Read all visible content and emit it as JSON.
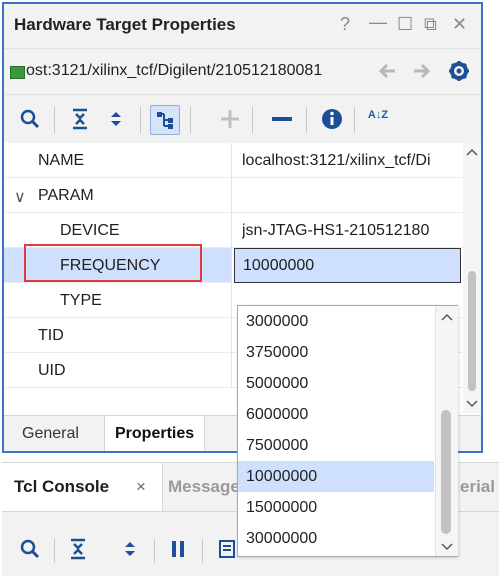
{
  "panel": {
    "title": "Hardware Target Properties",
    "window_controls": [
      "?",
      "—",
      "☐",
      "⧉",
      "✕"
    ],
    "path": "ost:3121/xilinx_tcf/Digilent/210512180081",
    "path_buttons": {
      "back": "back-arrow-icon",
      "forward": "forward-arrow-icon",
      "settings": "gear-icon"
    },
    "toolbar_icons": [
      "search-icon",
      "collapse-all-icon",
      "expand-all-icon",
      "group-icon",
      "add-icon",
      "remove-icon",
      "info-icon",
      "sort-icon"
    ],
    "sort_label": "A↓Z",
    "properties": [
      {
        "name": "NAME",
        "value": "localhost:3121/xilinx_tcf/Di",
        "indent": 0
      },
      {
        "name": "PARAM",
        "value": "",
        "indent": 0,
        "expander": "∨"
      },
      {
        "name": "DEVICE",
        "value": "jsn-JTAG-HS1-210512180",
        "indent": 1
      },
      {
        "name": "FREQUENCY",
        "value": "10000000",
        "indent": 1,
        "selected": true
      },
      {
        "name": "TYPE",
        "value": "",
        "indent": 1
      },
      {
        "name": "TID",
        "value": "",
        "indent": 0
      },
      {
        "name": "UID",
        "value": "",
        "indent": 0
      }
    ],
    "tabs": [
      {
        "label": "General",
        "active": false
      },
      {
        "label": "Properties",
        "active": true
      }
    ]
  },
  "dropdown": {
    "options": [
      "3000000",
      "3750000",
      "5000000",
      "6000000",
      "7500000",
      "10000000",
      "15000000",
      "30000000"
    ],
    "selected": "10000000"
  },
  "lower": {
    "tabs": [
      {
        "label": "Tcl Console",
        "active": true,
        "close": "×"
      },
      {
        "label": "Messages",
        "active": false
      },
      {
        "label": "erial",
        "active": false
      }
    ],
    "toolbar_icons": [
      "search-icon",
      "collapse-all-icon",
      "expand-all-icon",
      "pause-icon",
      "clear-icon"
    ]
  },
  "colors": {
    "accent": "#3b73c6",
    "highlight_box": "#e03c3c",
    "selected_row": "#cfe0ff",
    "icon_blue": "#1e5aa8"
  }
}
